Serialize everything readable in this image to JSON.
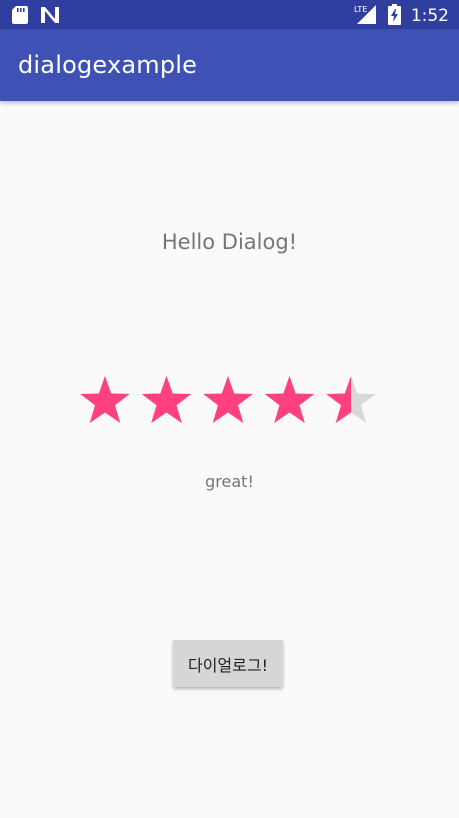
{
  "status_bar": {
    "time": "1:52",
    "network": "LTE",
    "icons": [
      "sd-card-icon",
      "n-notification-icon",
      "lte-signal-icon",
      "battery-charging-icon"
    ]
  },
  "app_bar": {
    "title": "dialogexample",
    "color": "#3f51b5",
    "status_color": "#303f9f"
  },
  "main": {
    "hello_text": "Hello Dialog!",
    "rating": {
      "value": 4.5,
      "max": 5,
      "filled_color": "#ff4081",
      "empty_color": "#d9d9d9"
    },
    "feedback_text": "great!",
    "button_label": "다이얼로그!"
  }
}
